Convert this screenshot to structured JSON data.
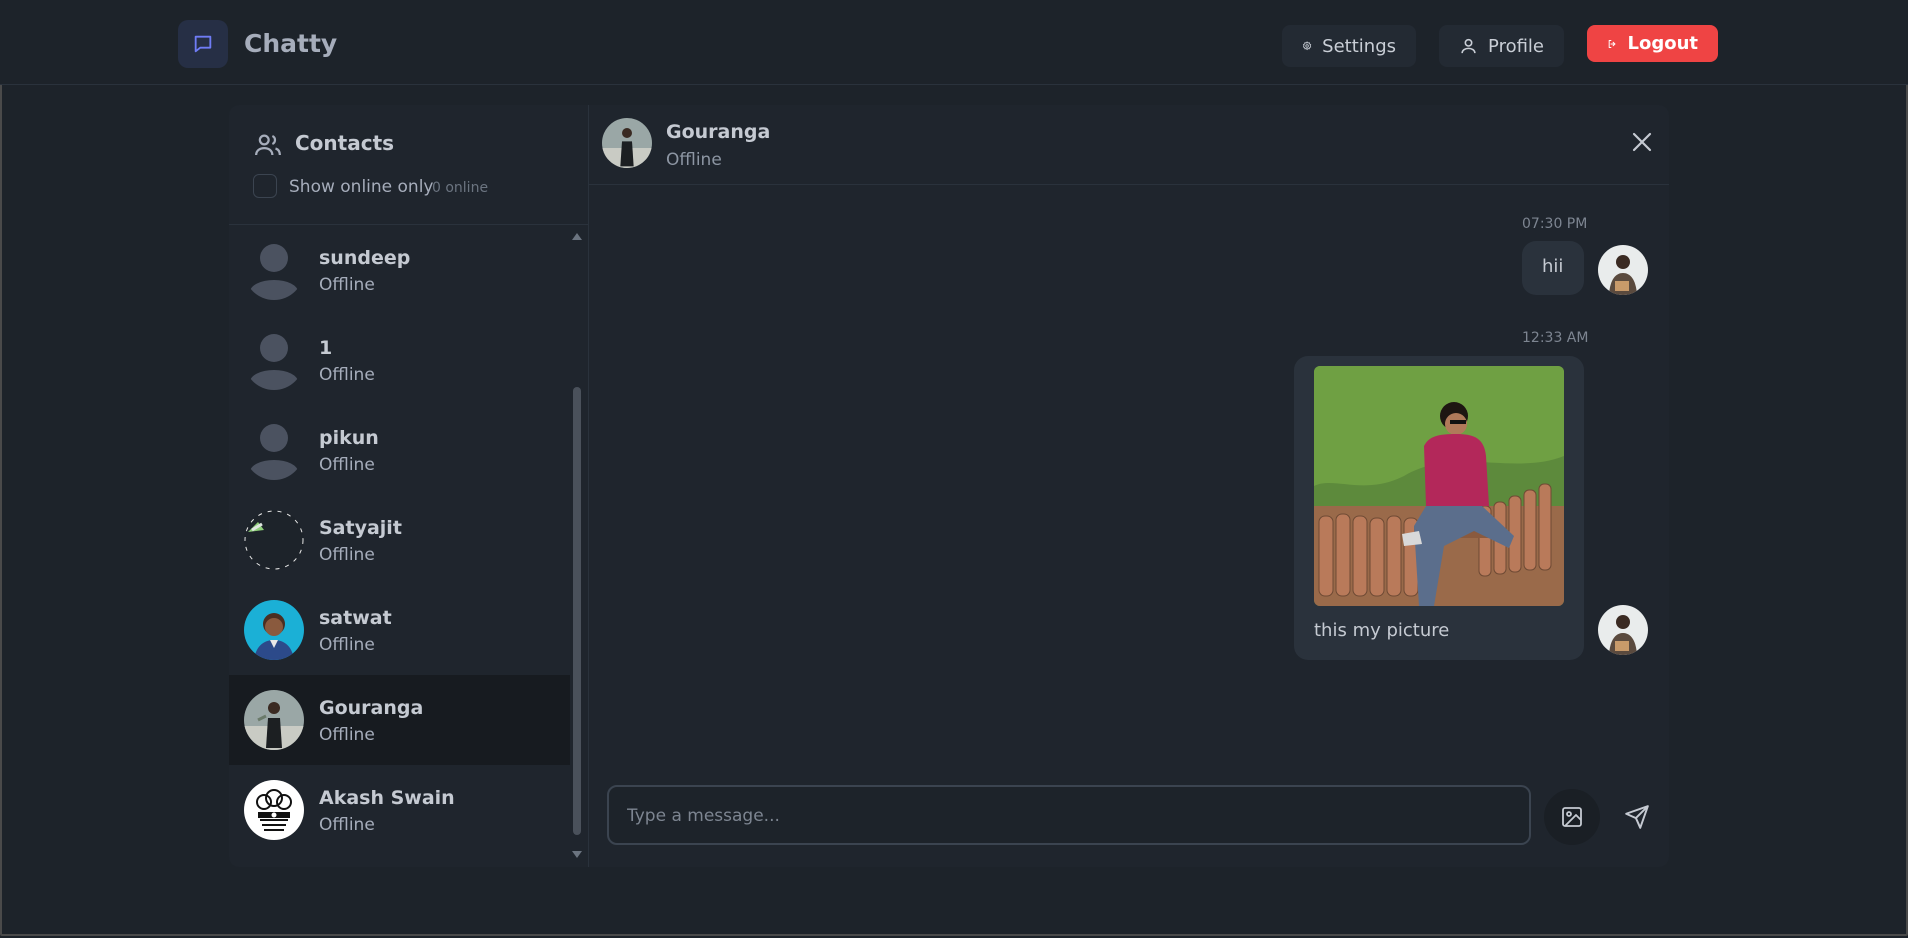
{
  "header": {
    "app_name": "Chatty",
    "settings_label": "Settings",
    "profile_label": "Profile",
    "logout_label": "Logout"
  },
  "sidebar": {
    "title": "Contacts",
    "filter_label": "Show online only",
    "online_count": "0 online",
    "contacts": [
      {
        "name": "sundeep",
        "status": "Offline",
        "avatar": "default-avatar-icon"
      },
      {
        "name": "1",
        "status": "Offline",
        "avatar": "default-avatar-icon"
      },
      {
        "name": "pikun",
        "status": "Offline",
        "avatar": "default-avatar-icon"
      },
      {
        "name": "Satyajit",
        "status": "Offline",
        "avatar": "photo"
      },
      {
        "name": "satwat",
        "status": "Offline",
        "avatar": "photo"
      },
      {
        "name": "Gouranga",
        "status": "Offline",
        "avatar": "photo"
      },
      {
        "name": "Akash Swain",
        "status": "Offline",
        "avatar": "emblem"
      }
    ]
  },
  "chat": {
    "contact_name": "Gouranga",
    "contact_status": "Offline",
    "messages": [
      {
        "time": "07:30 PM",
        "text": "hii"
      },
      {
        "time": "12:33 AM",
        "text": "this my picture",
        "has_image": true
      }
    ],
    "input_placeholder": "Type a message..."
  },
  "colors": {
    "background": "#1d232a",
    "panel": "#1f252d",
    "bubble": "#2a323c",
    "logout": "#ef4444",
    "accent": "#6f7cf5"
  }
}
